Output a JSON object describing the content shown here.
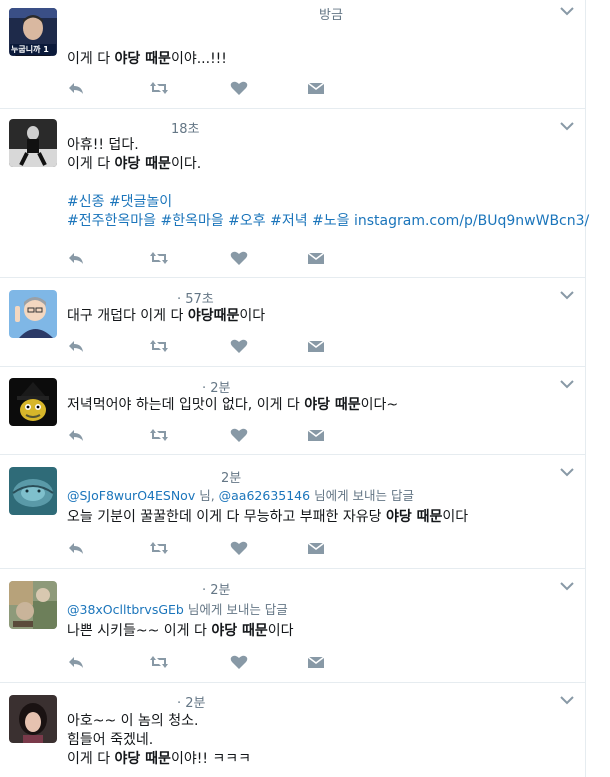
{
  "tweets": [
    {
      "time": "방금",
      "lines": [
        [
          {
            "t": "이게 다 "
          },
          {
            "t": "야당 때문",
            "b": true
          },
          {
            "t": "이야...!!!"
          }
        ]
      ]
    },
    {
      "time": "18초",
      "lines": [
        [
          {
            "t": "아휴!! 덥다."
          }
        ],
        [
          {
            "t": "이게 다 "
          },
          {
            "t": "야당 때문",
            "b": true
          },
          {
            "t": "이다."
          }
        ],
        [],
        [
          {
            "t": "#신종 #댓글놀이",
            "link": true
          }
        ],
        [
          {
            "t": "#전주한옥마을 #한옥마을 #오후 #저녁 #노을 instagram.com/p/BUq9nwWBcn3/",
            "link": true
          }
        ]
      ]
    },
    {
      "time": "· 57초",
      "lines": [
        [
          {
            "t": "대구 개덥다 이게 다 "
          },
          {
            "t": "야당때문",
            "b": true
          },
          {
            "t": "이다"
          }
        ]
      ]
    },
    {
      "time": "· 2분",
      "lines": [
        [
          {
            "t": "저녁먹어야 하는데 입맛이 없다, 이게 다 "
          },
          {
            "t": "야당 때문",
            "b": true
          },
          {
            "t": "이다~"
          }
        ]
      ]
    },
    {
      "time": "2분",
      "reply": [
        {
          "t": "@SJoF8wurO4ESNov",
          "link": true
        },
        {
          "t": " 님, "
        },
        {
          "t": "@aa62635146",
          "link": true
        },
        {
          "t": " 님에게 보내는 답글"
        }
      ],
      "lines": [
        [
          {
            "t": "오늘 기분이 꿀꿀한데 이게 다 무능하고 부패한 자유당 "
          },
          {
            "t": "야당 때문",
            "b": true
          },
          {
            "t": "이다"
          }
        ]
      ]
    },
    {
      "time": "· 2분",
      "reply": [
        {
          "t": "@38xOclltbrvsGEb",
          "link": true
        },
        {
          "t": " 님에게 보내는 답글"
        }
      ],
      "lines": [
        [
          {
            "t": "나쁜 시키들~~ 이게 다 "
          },
          {
            "t": "야당 때문",
            "b": true
          },
          {
            "t": "이다"
          }
        ]
      ]
    },
    {
      "time": "· 2분",
      "lines": [
        [
          {
            "t": "아호~~ 이 놈의 청소."
          }
        ],
        [
          {
            "t": "힘들어 죽겠네."
          }
        ],
        [
          {
            "t": "이게 다 "
          },
          {
            "t": "야당 때문",
            "b": true
          },
          {
            "t": "이야!! ㅋㅋㅋ"
          }
        ]
      ]
    }
  ],
  "avatar1_badge": "누굽니까 1",
  "icons": {
    "reply": "reply-icon",
    "retweet": "retweet-icon",
    "like": "heart-icon",
    "dm": "envelope-icon",
    "more": "chevron-down-icon"
  },
  "colors": {
    "link": "#1b75bb",
    "icon": "#8899a6",
    "divider": "#e6ecf0",
    "meta": "#657786"
  }
}
